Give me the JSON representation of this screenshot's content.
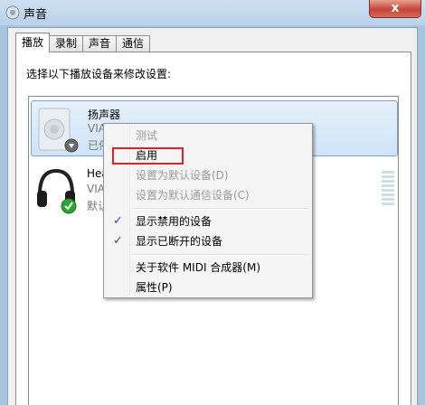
{
  "window": {
    "title": "声音",
    "close_label": "x"
  },
  "tabs": [
    {
      "label": "播放",
      "active": true
    },
    {
      "label": "录制",
      "active": false
    },
    {
      "label": "声音",
      "active": false
    },
    {
      "label": "通信",
      "active": false
    }
  ],
  "instruction": "选择以下播放设备来修改设置:",
  "devices": [
    {
      "name": "扬声器",
      "driver": "VIA HD Audio",
      "status": "已停用",
      "icon": "speaker-icon",
      "badge": "disabled-arrow-icon",
      "selected": true
    },
    {
      "name": "Headphones",
      "driver": "VIA HD Audio",
      "status": "默认设备",
      "icon": "headphones-icon",
      "badge": "default-check-icon",
      "selected": false
    }
  ],
  "visible_device_text": {
    "speaker": {
      "name": "扬声器",
      "driver": "VIA HD Audio",
      "status": "已停"
    },
    "headphones": {
      "name": "Hea",
      "driver": "VIA",
      "status": "默认"
    }
  },
  "context_menu": {
    "test": "测试",
    "enable": "启用",
    "set_default": "设置为默认设备(D)",
    "set_default_comm": "设置为默认通信设备(C)",
    "show_disabled": "显示禁用的设备",
    "show_disconnected": "显示已断开的设备",
    "about_midi": "关于软件 MIDI 合成器(M)",
    "properties": "属性(P)",
    "check_glyph": "✓",
    "highlight_color": "#e0212b"
  }
}
